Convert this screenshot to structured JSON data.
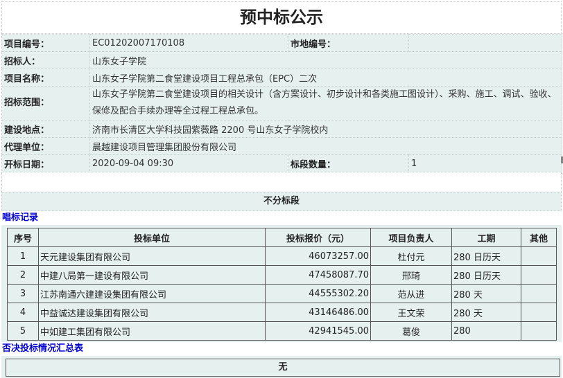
{
  "title": "预中标公示",
  "info": {
    "project_no_label": "项目编号：",
    "project_no": "EC01202007170108",
    "city_no_label": "市地编号：",
    "city_no": "",
    "tenderer_label": "招标人：",
    "tenderer": "山东女子学院",
    "project_name_label": "项目名称：",
    "project_name": "山东女子学院第二食堂建设项目工程总承包（EPC）二次",
    "scope_label": "招标范围：",
    "scope": "山东女子学院第二食堂建设项目的相关设计（含方案设计、初步设计和各类施工图设计）、采购、施工、调试、验收、保修及配合手续办理等全过程工程总承包。",
    "location_label": "建设地点：",
    "location": "济南市长清区大学科技园紫薇路 2200 号山东女子学院校内",
    "agent_label": "代理单位：",
    "agent": "晨越建设项目管理集团股份有限公司",
    "open_date_label": "开标日期：",
    "open_date": "2020-09-04 09:30",
    "lots_label": "标段数量：",
    "lots": "1"
  },
  "section_title": "不分标段",
  "bid_record_title": "唱标记录",
  "bid_table": {
    "headers": [
      "序号",
      "投标单位",
      "投标报价（元）",
      "项目负责人",
      "工期",
      "其他"
    ],
    "rows": [
      [
        "1",
        "天元建设集团有限公司",
        "46073257.00",
        "杜付元",
        "280 日历天",
        ""
      ],
      [
        "2",
        "中建八局第一建设有限公司",
        "47458087.70",
        "邢琦",
        "280 日历天",
        ""
      ],
      [
        "3",
        "江苏南通六建建设集团有限公司",
        "44555302.20",
        "范从进",
        "280 天",
        ""
      ],
      [
        "4",
        "中益诚达建设集团有限公司",
        "43146486.00",
        "王文荣",
        "280 天",
        ""
      ],
      [
        "5",
        "中如建工集团有限公司",
        "42941545.00",
        "葛俊",
        "280",
        ""
      ]
    ]
  },
  "reject_title": "否决投标情况汇总表",
  "reject_value": "无"
}
